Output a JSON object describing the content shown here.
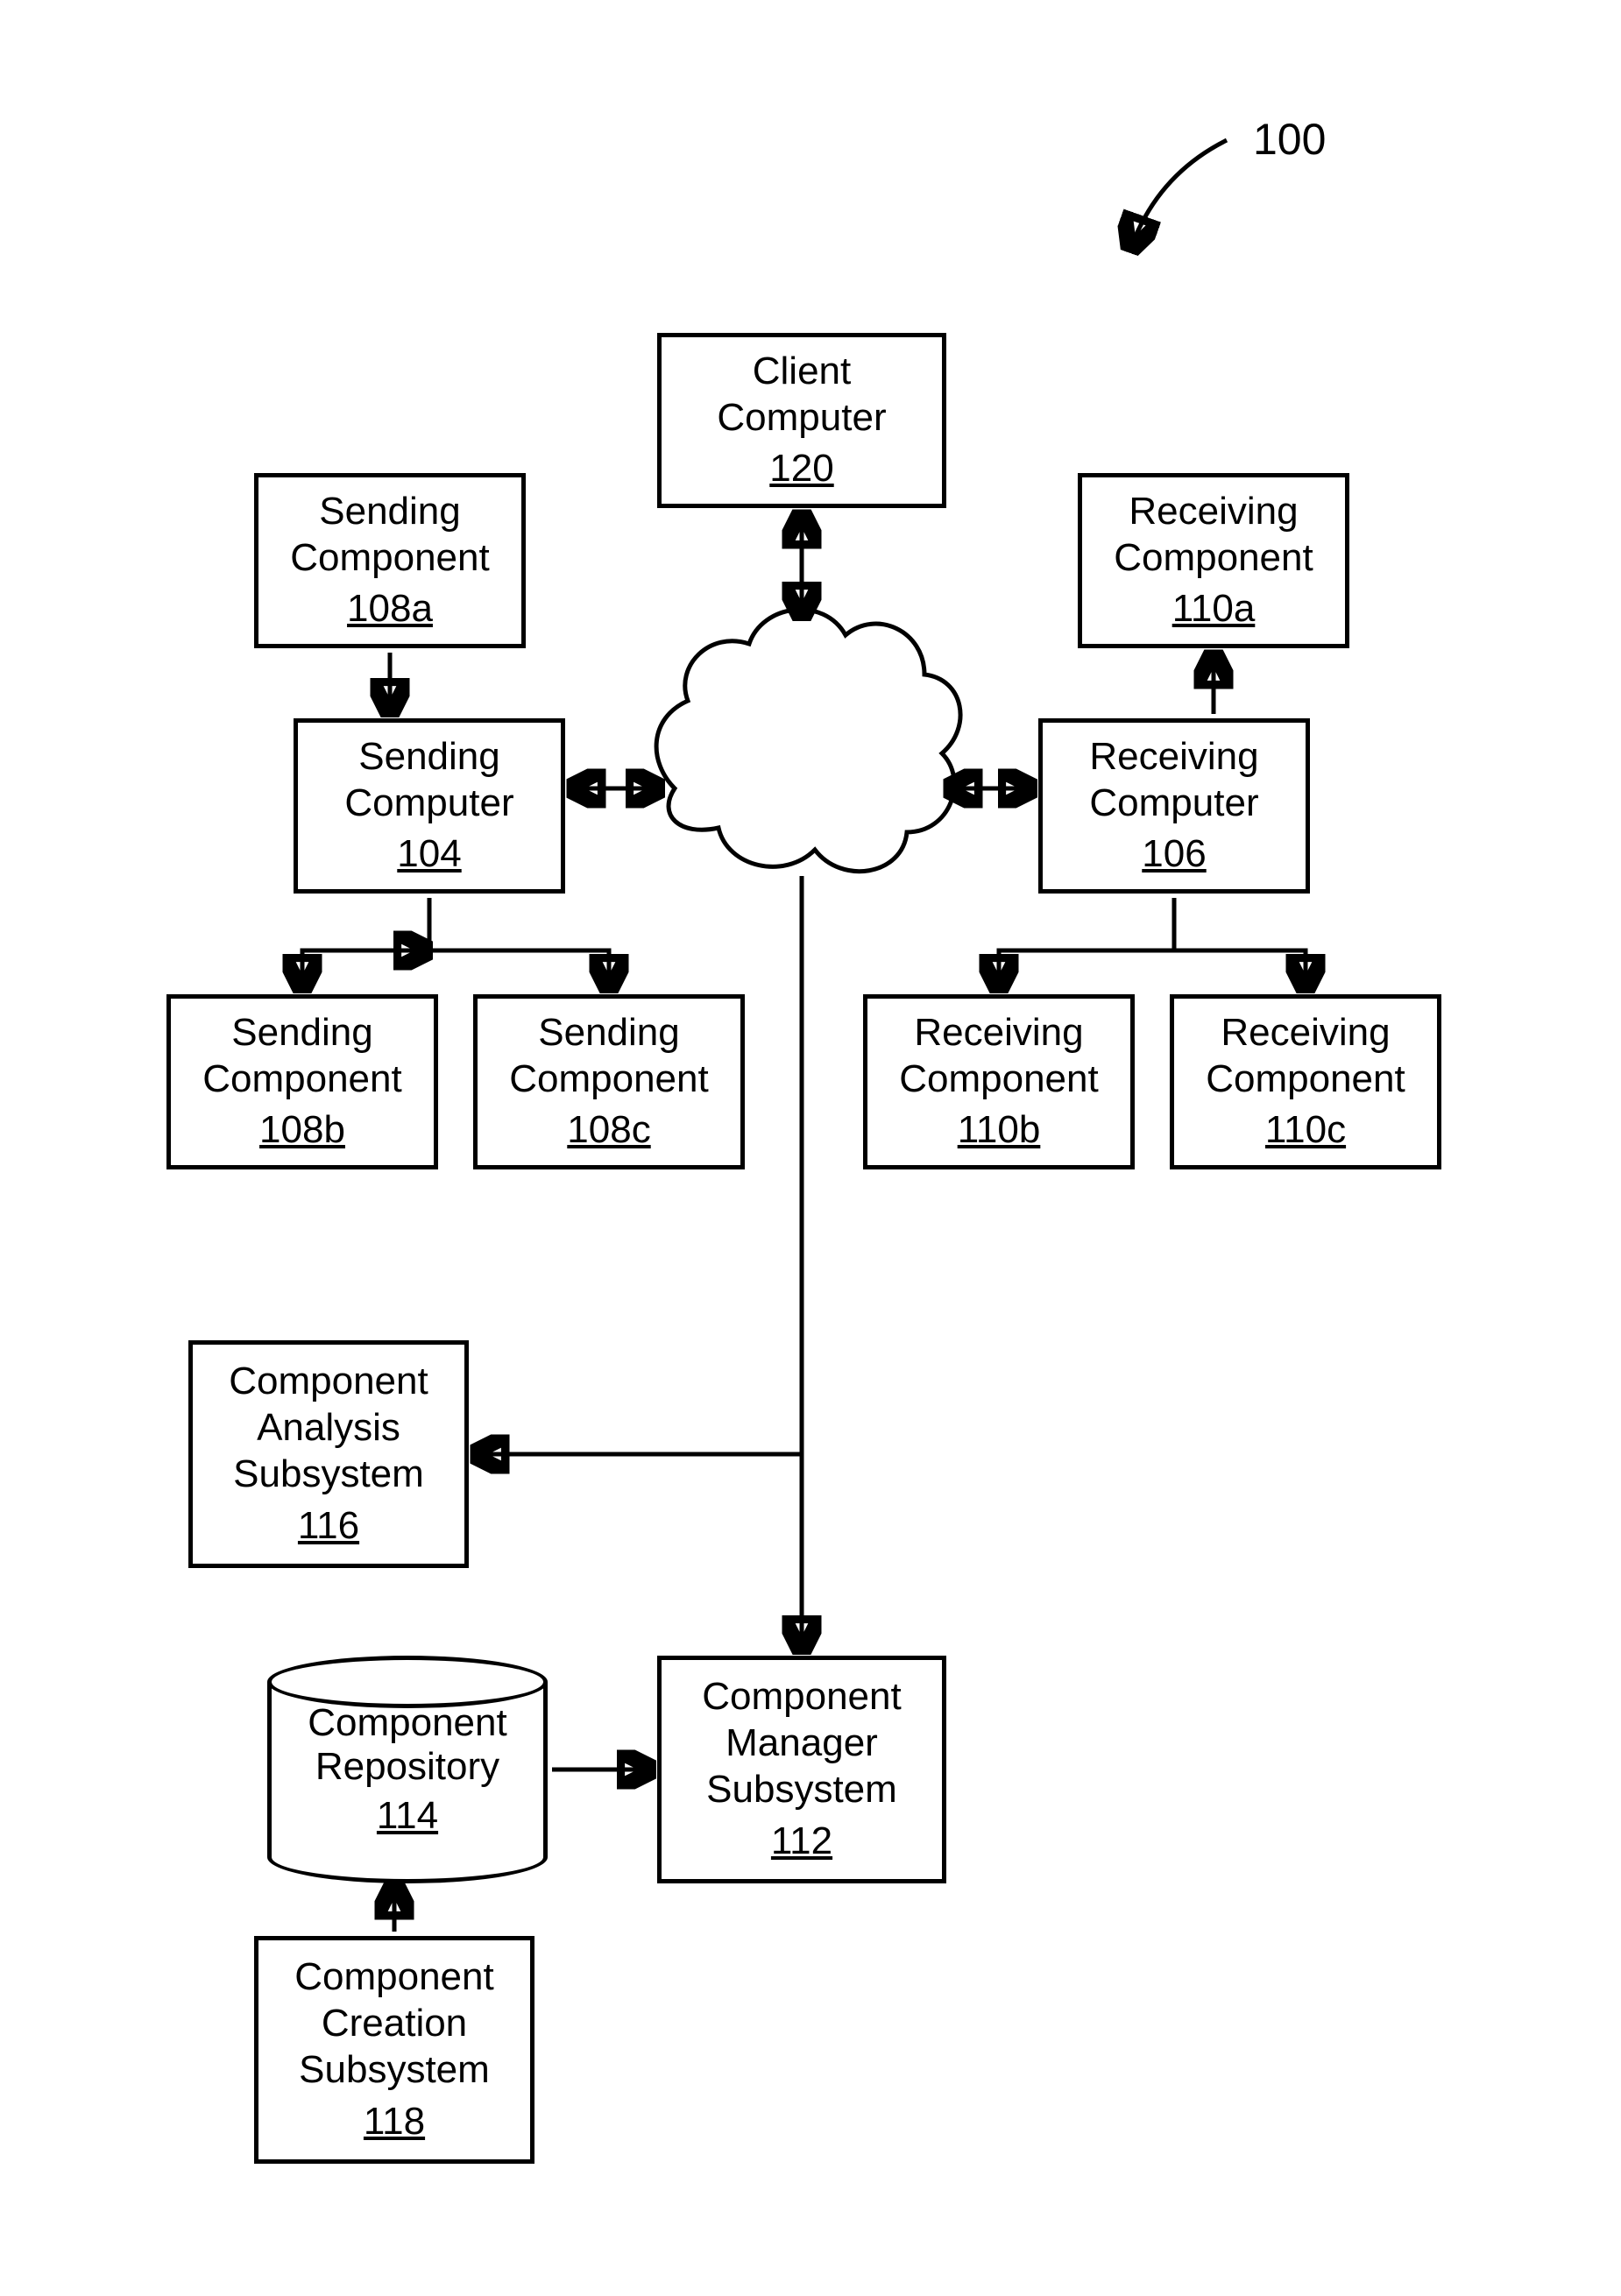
{
  "diagram": {
    "title_ref": "100",
    "nodes": {
      "client": {
        "l1": "Client",
        "l2": "Computer",
        "ref": "120"
      },
      "send_a": {
        "l1": "Sending",
        "l2": "Component",
        "ref": "108a"
      },
      "send_b": {
        "l1": "Sending",
        "l2": "Component",
        "ref": "108b"
      },
      "send_c": {
        "l1": "Sending",
        "l2": "Component",
        "ref": "108c"
      },
      "send_pc": {
        "l1": "Sending",
        "l2": "Computer",
        "ref": "104"
      },
      "recv_a": {
        "l1": "Receiving",
        "l2": "Component",
        "ref": "110a"
      },
      "recv_b": {
        "l1": "Receiving",
        "l2": "Component",
        "ref": "110b"
      },
      "recv_c": {
        "l1": "Receiving",
        "l2": "Component",
        "ref": "110c"
      },
      "recv_pc": {
        "l1": "Receiving",
        "l2": "Computer",
        "ref": "106"
      },
      "analysis": {
        "l1": "Component",
        "l2": "Analysis",
        "l3": "Subsystem",
        "ref": "116"
      },
      "repo": {
        "l1": "Component",
        "l2": "Repository",
        "ref": "114"
      },
      "manager": {
        "l1": "Component",
        "l2": "Manager",
        "l3": "Subsystem",
        "ref": "112"
      },
      "creation": {
        "l1": "Component",
        "l2": "Creation",
        "l3": "Subsystem",
        "ref": "118"
      }
    }
  }
}
